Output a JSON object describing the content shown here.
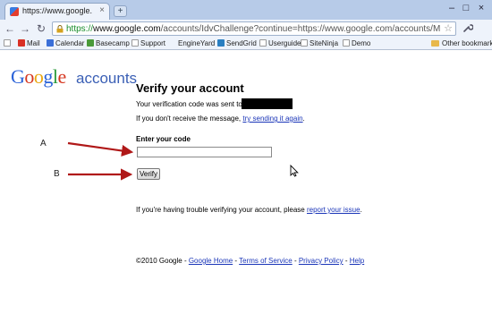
{
  "tab": {
    "title": "https://www.google.com/a...",
    "close_glyph": "×",
    "newtab_glyph": "+"
  },
  "window_controls": {
    "minimize": "–",
    "maximize": "□",
    "close": "×"
  },
  "nav": {
    "back": "←",
    "forward": "→",
    "reload": "↻",
    "wrench": "🔧",
    "star": "☆"
  },
  "address": {
    "scheme": "https://",
    "host": "www.google.com",
    "path": "/accounts/IdvChallenge?continue=https://www.google.com/accounts/ManageAccount&followup="
  },
  "bookmarks": [
    {
      "label": "Mail",
      "icon": "gmail-icon",
      "color": "#d93025"
    },
    {
      "label": "Calendar",
      "icon": "calendar-icon",
      "color": "#3a6fd8"
    },
    {
      "label": "Basecamp",
      "icon": "basecamp-icon",
      "color": "#4a9a3a"
    },
    {
      "label": "Support",
      "icon": "page-icon",
      "color": "#8a8a8a"
    },
    {
      "label": "EngineYard",
      "icon": "blank-icon",
      "color": "#eef3fb"
    },
    {
      "label": "SendGrid",
      "icon": "sendgrid-icon",
      "color": "#2a7fc1"
    },
    {
      "label": "Userguide",
      "icon": "page-icon",
      "color": "#8a8a8a"
    },
    {
      "label": "SiteNinja",
      "icon": "page-icon",
      "color": "#8a8a8a"
    },
    {
      "label": "Demo",
      "icon": "page-icon",
      "color": "#8a8a8a"
    }
  ],
  "other_bookmarks": "Other bookmarks",
  "logo": {
    "g1": "G",
    "o1": "o",
    "o2": "o",
    "g2": "g",
    "l": "l",
    "e": "e",
    "sub": "accounts"
  },
  "page": {
    "heading": "Verify your account",
    "sent_prefix": "Your verification code was sent to",
    "resend_prefix": "If you don't receive the message,",
    "resend_link": "try sending it again",
    "resend_suffix": ".",
    "code_label": "Enter your code",
    "code_value": "",
    "verify_label": "Verify",
    "trouble_prefix": "If you're having trouble verifying your account, please",
    "trouble_link": "report your issue",
    "trouble_suffix": "."
  },
  "footer": {
    "copyright": "©2010 Google",
    "sep": " - ",
    "links": [
      "Google Home",
      "Terms of Service",
      "Privacy Policy",
      "Help"
    ]
  },
  "annotations": {
    "a": "A",
    "b": "B",
    "arrow_color": "#b01818"
  }
}
